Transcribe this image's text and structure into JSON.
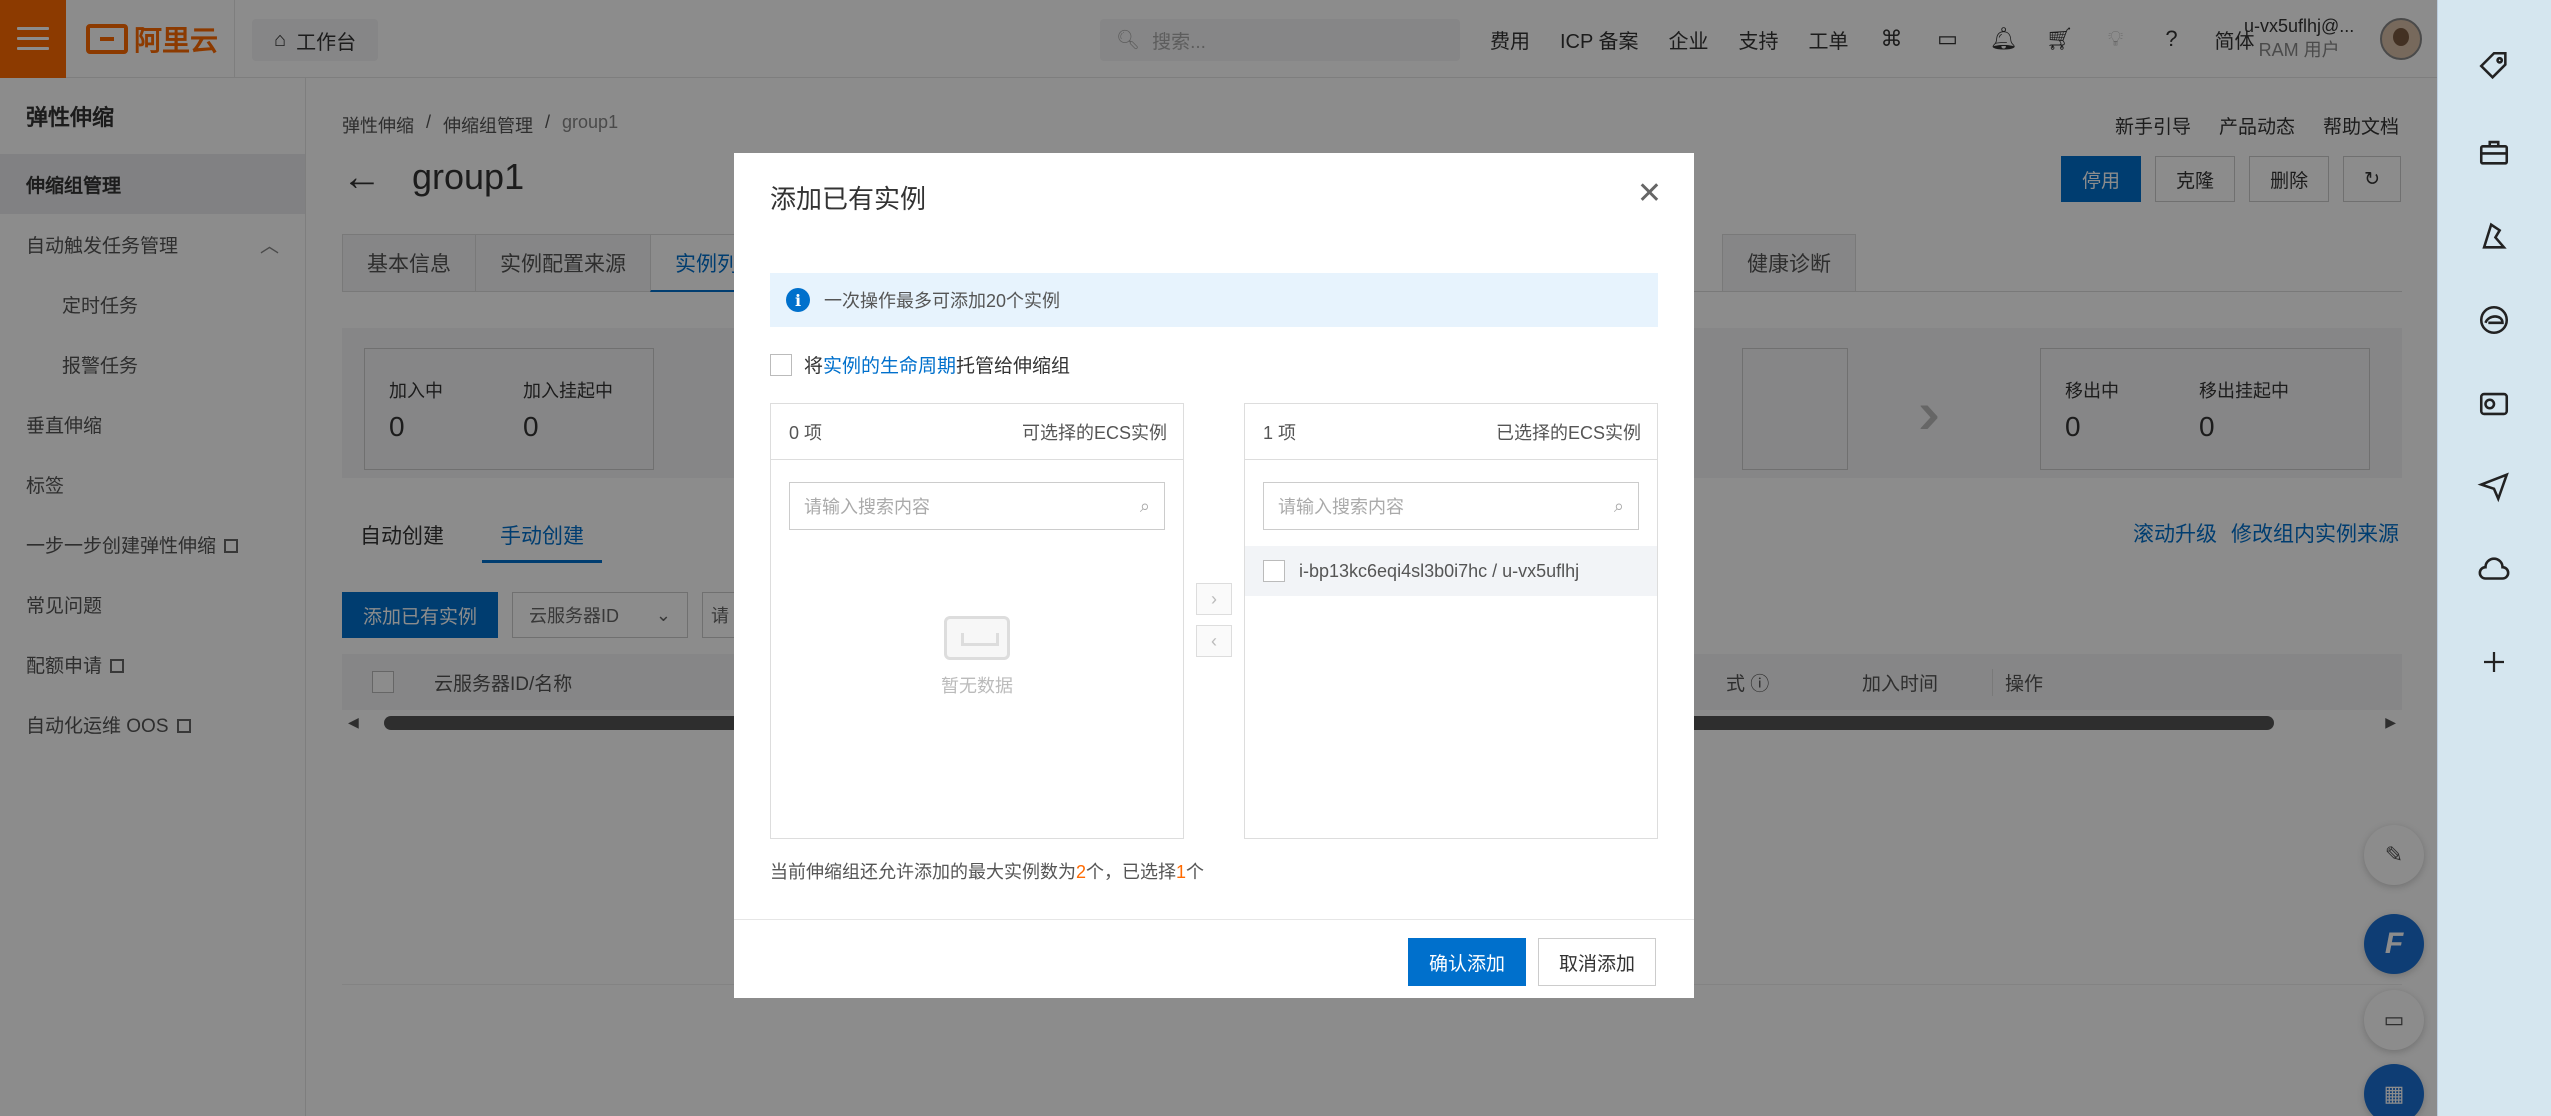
{
  "topbar": {
    "logo_text": "阿里云",
    "workbench": "工作台",
    "search_placeholder": "搜索...",
    "nav": [
      "费用",
      "ICP 备案",
      "企业",
      "支持",
      "工单"
    ],
    "lang": "简体",
    "user_name": "u-vx5uflhj@...",
    "user_role": "RAM 用户"
  },
  "sidebar": {
    "title": "弹性伸缩",
    "items": [
      {
        "label": "伸缩组管理"
      },
      {
        "label": "自动触发任务管理"
      },
      {
        "label": "定时任务"
      },
      {
        "label": "报警任务"
      },
      {
        "label": "垂直伸缩"
      },
      {
        "label": "标签"
      },
      {
        "label": "一步一步创建弹性伸缩"
      },
      {
        "label": "常见问题"
      },
      {
        "label": "配额申请"
      },
      {
        "label": "自动化运维 OOS"
      }
    ]
  },
  "main": {
    "breadcrumb": [
      "弹性伸缩",
      "伸缩组管理",
      "group1"
    ],
    "help_links": [
      "新手引导",
      "产品动态",
      "帮助文档"
    ],
    "title": "group1",
    "actions": [
      "停用",
      "克隆",
      "删除"
    ],
    "tabs": [
      "基本信息",
      "实例配置来源",
      "实例列"
    ],
    "tab_far": "健康诊断",
    "stats_left": [
      {
        "label": "加入中",
        "value": "0"
      },
      {
        "label": "加入挂起中",
        "value": "0"
      }
    ],
    "stats_right": [
      {
        "label": "移出中",
        "value": "0"
      },
      {
        "label": "移出挂起中",
        "value": "0"
      }
    ],
    "subtabs": [
      "自动创建",
      "手动创建"
    ],
    "right_links": [
      "滚动升级",
      "修改组内实例来源"
    ],
    "add_button": "添加已有实例",
    "filter_select": "云服务器ID",
    "filter_input_hint": "请",
    "table_headers": [
      "云服务器ID/名称",
      "式",
      "加入时间",
      "操作"
    ]
  },
  "dialog": {
    "title": "添加已有实例",
    "notice": "一次操作最多可添加20个实例",
    "lifecycle_prefix": "将",
    "lifecycle_link": "实例的生命周期",
    "lifecycle_suffix": "托管给伸缩组",
    "left_panel": {
      "count": "0 项",
      "title": "可选择的ECS实例",
      "search_placeholder": "请输入搜索内容",
      "empty_text": "暂无数据"
    },
    "right_panel": {
      "count": "1 项",
      "title": "已选择的ECS实例",
      "search_placeholder": "请输入搜索内容",
      "items": [
        "i-bp13kc6eqi4sl3b0i7hc / u-vx5uflhj"
      ]
    },
    "limit_prefix": "当前伸缩组还允许添加的最大实例数为",
    "limit_max": "2",
    "limit_mid": "个，已选择",
    "limit_selected": "1",
    "limit_suffix": "个",
    "confirm": "确认添加",
    "cancel": "取消添加"
  },
  "colors": {
    "brand": "#ff6a00",
    "primary": "#0070cc",
    "notice_bg": "#e7f3fd"
  }
}
